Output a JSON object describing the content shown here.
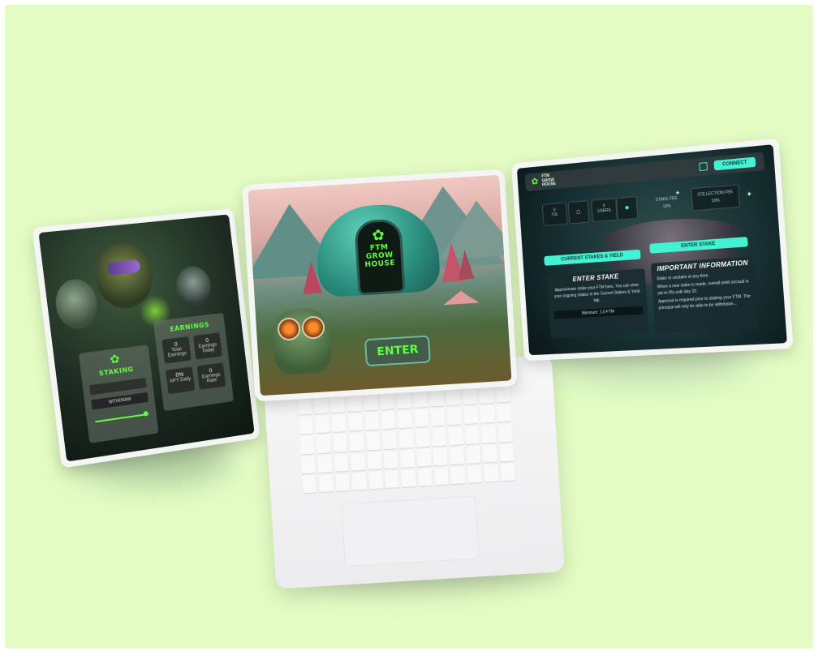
{
  "left_tablet": {
    "staking_title": "STAKING",
    "earnings_title": "EARNINGS",
    "stake_button": "WITHDRAW",
    "cells": [
      {
        "value": "0",
        "label": "Total Earnings"
      },
      {
        "value": "0",
        "label": "Earnings Today"
      },
      {
        "value": "0%",
        "label": "APY Daily"
      },
      {
        "value": "0",
        "label": "Earnings Rate"
      }
    ]
  },
  "center_screen": {
    "sign_line1": "FTM",
    "sign_line2": "GROW",
    "sign_line3": "HOUSE",
    "enter_button": "ENTER"
  },
  "right_tablet": {
    "logo_line1": "FTM",
    "logo_line2": "GROW",
    "logo_line3": "HOUSE",
    "connect_button": "CONNECT",
    "stats": [
      {
        "value": "0",
        "label": "TVL"
      },
      {
        "value": "0",
        "label": "USERS"
      },
      {
        "value": "STAKE FEE",
        "label": "10%"
      },
      {
        "value": "COLLECTION FEE",
        "label": "10%"
      }
    ],
    "tab_current": "CURRENT STAKES & YIELD",
    "tab_enter": "ENTER STAKE",
    "enter_stake_title": "ENTER STAKE",
    "enter_stake_text": "Approximate stake your FTM here. You can view your ongoing stakes in the Current Stakes & Yield tab.",
    "enter_stake_min": "Minimum: 1.0 FTM",
    "info_title": "IMPORTANT INFORMATION",
    "info_line1": "Stake or unstake at any time.",
    "info_line2": "When a new stake is made, overall yield accrual is set to 0% until day 20.",
    "info_line3": "Approval is required prior to staking your FTM. The principal will only be able to be withdrawn..."
  },
  "colors": {
    "background": "#e3fcc4",
    "neon_green": "#5dff3c",
    "cyan": "#43f2d2"
  }
}
